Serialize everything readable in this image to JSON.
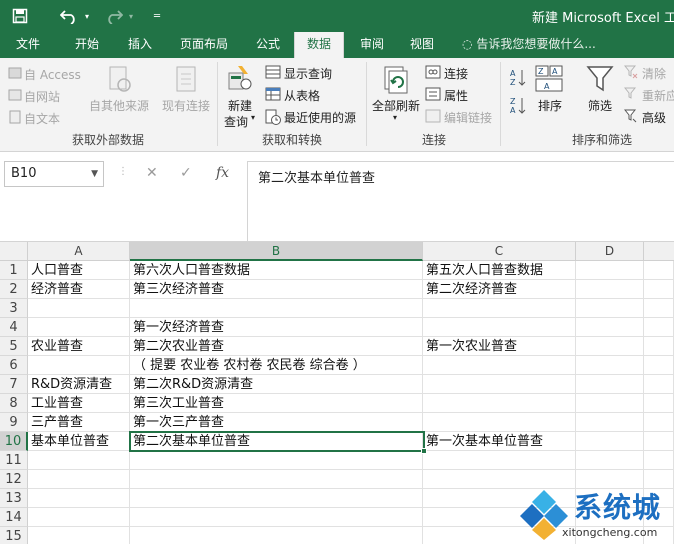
{
  "title_bar": {
    "title": "新建 Microsoft Excel 工作",
    "save_icon": "save-icon",
    "undo_icon": "undo-icon",
    "redo_icon": "redo-icon",
    "qa_menu_icon": "customize-quick-access-icon",
    "color": "#217346"
  },
  "tabs": [
    "文件",
    "开始",
    "插入",
    "页面布局",
    "公式",
    "数据",
    "审阅",
    "视图"
  ],
  "active_tab": "数据",
  "tell_me": "告诉我您想要做什么...",
  "ribbon": {
    "get_external": {
      "access": "自 Access",
      "web": "自网站",
      "text": "自文本",
      "other": "自其他来源",
      "existing": "现有连接",
      "label": "获取外部数据"
    },
    "get_transform": {
      "new_query_1": "新建",
      "new_query_2": "查询",
      "show_queries": "显示查询",
      "from_table": "从表格",
      "recent_sources": "最近使用的源",
      "label": "获取和转换"
    },
    "connections": {
      "refresh_all": "全部刷新",
      "connections": "连接",
      "properties": "属性",
      "edit_links": "编辑链接",
      "label": "连接"
    },
    "sort_filter": {
      "sort": "排序",
      "filter": "筛选",
      "clear": "清除",
      "reapply": "重新应",
      "advanced": "高级",
      "label": "排序和筛选"
    }
  },
  "formula_bar": {
    "name_box": "B10",
    "fx": "fx",
    "formula": "第二次基本单位普查"
  },
  "columns": [
    "A",
    "B",
    "C",
    "D"
  ],
  "rows": [
    {
      "num": "1",
      "a": "人口普查",
      "b": "第六次人口普查数据",
      "c": "第五次人口普查数据"
    },
    {
      "num": "2",
      "a": "经济普查",
      "b": "第三次经济普查",
      "c": "第二次经济普查"
    },
    {
      "num": "3",
      "a": "",
      "b": "",
      "c": ""
    },
    {
      "num": "4",
      "a": "",
      "b": "第一次经济普查",
      "c": ""
    },
    {
      "num": "5",
      "a": "农业普查",
      "b": "第二次农业普查",
      "c": "第一次农业普查"
    },
    {
      "num": "6",
      "a": "",
      "b": "（ 提要 农业卷 农村卷 农民卷 综合卷 ）",
      "c": ""
    },
    {
      "num": "7",
      "a": "R&D资源清查",
      "b": "第二次R&D资源清查",
      "c": ""
    },
    {
      "num": "8",
      "a": "工业普查",
      "b": "第三次工业普查",
      "c": ""
    },
    {
      "num": "9",
      "a": "三产普查",
      "b": "第一次三产普查",
      "c": ""
    },
    {
      "num": "10",
      "a": "基本单位普查",
      "b": "第二次基本单位普查",
      "c": "第一次基本单位普查"
    },
    {
      "num": "11",
      "a": "",
      "b": "",
      "c": ""
    },
    {
      "num": "12",
      "a": "",
      "b": "",
      "c": ""
    },
    {
      "num": "13",
      "a": "",
      "b": "",
      "c": ""
    },
    {
      "num": "14",
      "a": "",
      "b": "",
      "c": ""
    },
    {
      "num": "15",
      "a": "",
      "b": "",
      "c": ""
    }
  ],
  "selected_cell": "B10",
  "watermark": {
    "text": "系统城",
    "url": "xitongcheng.com"
  }
}
